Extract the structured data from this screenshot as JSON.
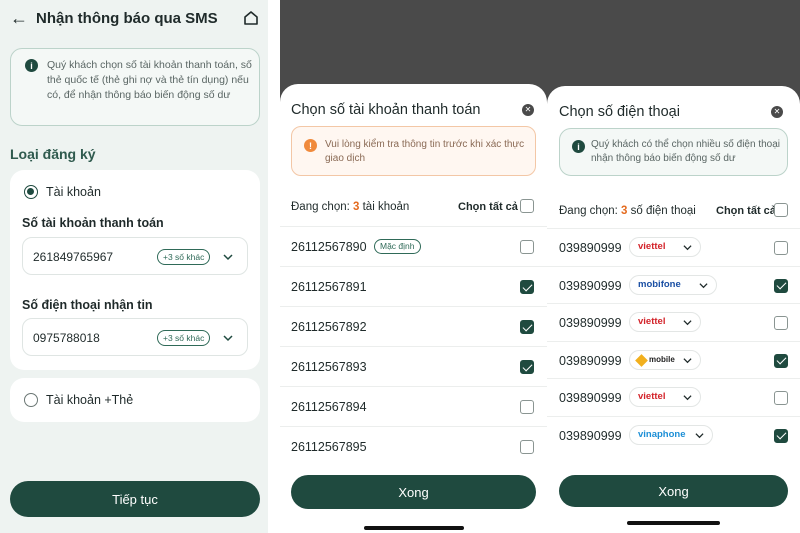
{
  "sms_screen": {
    "title": "Nhận thông báo qua SMS",
    "info": "Quý khách chọn số tài khoản thanh toán, số thẻ quốc tế (thẻ ghi nợ và thẻ tín dụng) nếu có, để nhận thông báo biến động số dư",
    "section_label": "Loại đăng ký",
    "option_account": "Tài khoản",
    "account_field_label": "Số tài khoản thanh toán",
    "account_value": "261849765967",
    "account_more": "+3 số khác",
    "phone_field_label": "Số điện thoại nhận tin",
    "phone_value": "0975788018",
    "phone_more": "+3 số khác",
    "option_account_card": "Tài khoản +Thẻ",
    "continue_label": "Tiếp tục"
  },
  "account_sheet": {
    "title": "Chọn số tài khoản thanh toán",
    "warning": "Vui lòng kiểm tra thông tin trước khi xác thực giao dịch",
    "selecting_prefix": "Đang chọn: ",
    "selecting_count": "3",
    "selecting_suffix": " tài khoản",
    "select_all": "Chọn tất cả",
    "default_badge": "Mặc định",
    "done_label": "Xong",
    "rows": [
      {
        "number": "26112567890",
        "checked": false
      },
      {
        "number": "26112567891",
        "checked": true
      },
      {
        "number": "26112567892",
        "checked": true
      },
      {
        "number": "26112567893",
        "checked": true
      },
      {
        "number": "26112567894",
        "checked": false
      },
      {
        "number": "26112567895",
        "checked": false
      }
    ]
  },
  "phone_sheet": {
    "title": "Chọn số điện thoại",
    "info": "Quý khách có thể chọn nhiều số điện thoại nhận thông báo biến động số dư",
    "selecting_prefix": "Đang chọn: ",
    "selecting_count": "3",
    "selecting_suffix": " số điện thoại",
    "select_all": "Chọn tất cả",
    "done_label": "Xong",
    "rows": [
      {
        "number": "039890999",
        "carrier": "viettel",
        "checked": false
      },
      {
        "number": "039890999",
        "carrier": "mobifone",
        "checked": true
      },
      {
        "number": "039890999",
        "carrier": "viettel",
        "checked": false
      },
      {
        "number": "039890999",
        "carrier": "mobile",
        "checked": true
      },
      {
        "number": "039890999",
        "carrier": "viettel",
        "checked": false
      },
      {
        "number": "039890999",
        "carrier": "vinaphone",
        "checked": true
      }
    ]
  },
  "colors": {
    "primary": "#1f4a3f",
    "accent_orange": "#e46b1f",
    "viettel": "#d3232a",
    "mobifone": "#1a4fa3",
    "vinaphone": "#1d8fd6",
    "mobile": "#222222"
  }
}
